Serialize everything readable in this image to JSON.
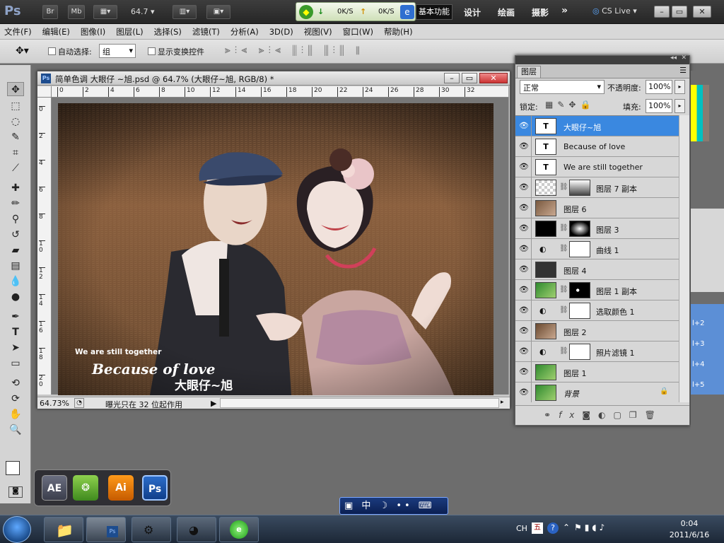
{
  "appbar": {
    "logo": "Ps",
    "br": "Br",
    "mb": "Mb",
    "zoom": "64.7",
    "net_down": "0K/S",
    "net_up": "0K/S",
    "workspaces": [
      "基本功能",
      "设计",
      "绘画",
      "摄影"
    ],
    "more": "»",
    "cslive": "CS Live",
    "win_min": "–",
    "win_max": "▭",
    "win_close": "✕"
  },
  "menubar": {
    "items": [
      "文件(F)",
      "编辑(E)",
      "图像(I)",
      "图层(L)",
      "选择(S)",
      "滤镜(T)",
      "分析(A)",
      "3D(D)",
      "视图(V)",
      "窗口(W)",
      "帮助(H)"
    ]
  },
  "options": {
    "auto_select_label": "自动选择:",
    "auto_select_value": "组",
    "show_transform_label": "显示变换控件"
  },
  "document": {
    "title": "简单色调 大眼仔 ~旭.psd @ 64.7% (大眼仔~旭, RGB/8) *",
    "zoom": "64.73%",
    "status_text": "曝光只在 32 位起作用",
    "ruler_top": [
      "0",
      "2",
      "4",
      "6",
      "8",
      "10",
      "12",
      "14",
      "16",
      "18",
      "20",
      "22",
      "24",
      "26",
      "28",
      "30",
      "32"
    ],
    "ruler_left": [
      "0",
      "2",
      "4",
      "6",
      "8",
      "1 0",
      "1 2",
      "1 4",
      "1 6",
      "1 8",
      "2 0"
    ]
  },
  "photo": {
    "text1": "We are still together",
    "text2": "Because of love",
    "text3": "大眼仔~旭"
  },
  "layers": {
    "tab": "图层",
    "blend_mode": "正常",
    "opacity_label": "不透明度:",
    "opacity": "100%",
    "lock_label": "锁定:",
    "fill_label": "填充:",
    "fill": "100%",
    "rows": [
      {
        "name": "大眼仔~旭",
        "kind": "text",
        "selected": true
      },
      {
        "name": "Because of love",
        "kind": "text"
      },
      {
        "name": "We are still together",
        "kind": "text"
      },
      {
        "name": "图层 7 副本",
        "kind": "masked"
      },
      {
        "name": "图层 6",
        "kind": "image"
      },
      {
        "name": "图层 3",
        "kind": "masked"
      },
      {
        "name": "曲线 1",
        "kind": "adjust"
      },
      {
        "name": "图层 4",
        "kind": "image"
      },
      {
        "name": "图层 1 副本",
        "kind": "masked"
      },
      {
        "name": "选取颜色 1",
        "kind": "adjust"
      },
      {
        "name": "图层 2",
        "kind": "image"
      },
      {
        "name": "照片滤镜 1",
        "kind": "adjust"
      },
      {
        "name": "图层 1",
        "kind": "image"
      },
      {
        "name": "背景",
        "kind": "image",
        "locked": true
      }
    ],
    "text_thumb": "T"
  },
  "rstrip": {
    "labels": [
      "l+2",
      "l+3",
      "l+4",
      "l+5"
    ]
  },
  "dock": {
    "apps": [
      "AE",
      "",
      "Ai",
      "Ps"
    ]
  },
  "ime": {
    "text": "中"
  },
  "taskbar": {
    "lang": "CH",
    "time": "0:04",
    "date": "2011/6/16"
  }
}
